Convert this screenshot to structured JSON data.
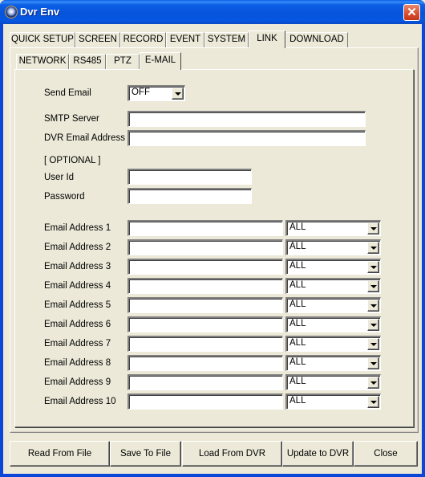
{
  "window": {
    "title": "Dvr Env",
    "close_label": "✕"
  },
  "main_tabs": [
    {
      "label": "QUICK SETUP",
      "active": false
    },
    {
      "label": "SCREEN",
      "active": false
    },
    {
      "label": "RECORD",
      "active": false
    },
    {
      "label": "EVENT",
      "active": false
    },
    {
      "label": "SYSTEM",
      "active": false
    },
    {
      "label": "LINK",
      "active": true
    },
    {
      "label": "DOWNLOAD",
      "active": false
    }
  ],
  "sub_tabs": [
    {
      "label": "NETWORK",
      "active": false
    },
    {
      "label": "RS485",
      "active": false
    },
    {
      "label": "PTZ",
      "active": false
    },
    {
      "label": "E-MAIL",
      "active": true
    }
  ],
  "form": {
    "send_email": {
      "label": "Send Email",
      "value": "OFF"
    },
    "smtp_server": {
      "label": "SMTP Server",
      "value": ""
    },
    "dvr_email": {
      "label": "DVR Email Address",
      "value": ""
    },
    "optional_label": "[ OPTIONAL ]",
    "user_id": {
      "label": "User Id",
      "value": ""
    },
    "password": {
      "label": "Password",
      "value": ""
    },
    "email_addresses": [
      {
        "label": "Email Address 1",
        "value": "",
        "filter": "ALL"
      },
      {
        "label": "Email Address 2",
        "value": "",
        "filter": "ALL"
      },
      {
        "label": "Email Address 3",
        "value": "",
        "filter": "ALL"
      },
      {
        "label": "Email Address 4",
        "value": "",
        "filter": "ALL"
      },
      {
        "label": "Email Address 5",
        "value": "",
        "filter": "ALL"
      },
      {
        "label": "Email Address 6",
        "value": "",
        "filter": "ALL"
      },
      {
        "label": "Email Address 7",
        "value": "",
        "filter": "ALL"
      },
      {
        "label": "Email Address 8",
        "value": "",
        "filter": "ALL"
      },
      {
        "label": "Email Address 9",
        "value": "",
        "filter": "ALL"
      },
      {
        "label": "Email Address 10",
        "value": "",
        "filter": "ALL"
      }
    ]
  },
  "buttons": {
    "read_from_file": "Read From File",
    "save_to_file": "Save To File",
    "load_from_dvr": "Load From DVR",
    "update_to_dvr": "Update to DVR",
    "close": "Close"
  }
}
